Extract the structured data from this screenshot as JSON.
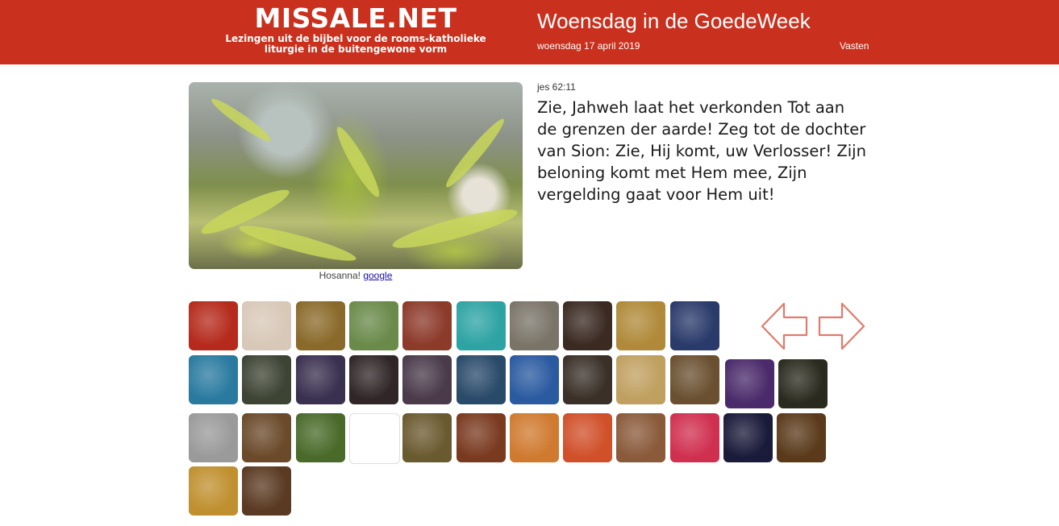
{
  "header": {
    "site_title": "MISSALE.NET",
    "site_subtitle_line1": "Lezingen uit de bijbel voor de rooms-katholieke",
    "site_subtitle_line2": "liturgie in de buitengewone vorm",
    "day_title": "Woensdag in de GoedeWeek",
    "date": "woensdag 17 april 2019",
    "season": "Vasten",
    "background_color": "#c9301d"
  },
  "feature": {
    "caption": "Hosanna!",
    "caption_link": "google"
  },
  "reading": {
    "reference": "jes 62:11",
    "text": "Zie, Jahweh laat het verkonden Tot aan de grenzen der aarde! Zeg tot de dochter van Sion: Zie, Hij komt, uw Verlosser! Zijn beloning komt met Hem mee, Zijn vergelding gaat voor Hem uit!"
  },
  "navigation": {
    "prev_icon": "arrow-left-icon",
    "next_icon": "arrow-right-icon",
    "arrow_color": "#e07b6d"
  },
  "gallery": {
    "thumbnails": [
      {
        "name": "thumb-crucifix-red",
        "color": "#b52a1c"
      },
      {
        "name": "thumb-pope",
        "color": "#d8c8b8"
      },
      {
        "name": "thumb-last-supper",
        "color": "#8a6a2a"
      },
      {
        "name": "thumb-stained-glass",
        "color": "#6a8a4a"
      },
      {
        "name": "thumb-supper-red",
        "color": "#8c3a2a"
      },
      {
        "name": "thumb-teal-circle",
        "color": "#2ea3a3"
      },
      {
        "name": "thumb-gethsemane-grey",
        "color": "#7a7468"
      },
      {
        "name": "thumb-kiss-judas",
        "color": "#3a2a22"
      },
      {
        "name": "thumb-rembrandt",
        "color": "#b08a3a"
      },
      {
        "name": "thumb-angel-blue",
        "color": "#2a3a6a"
      },
      {
        "name": "thumb-light-blue",
        "color": "#2a7aa0"
      },
      {
        "name": "thumb-agony-garden",
        "color": "#3e4434"
      },
      {
        "name": "thumb-arrest-crowd",
        "color": "#3a3050"
      },
      {
        "name": "thumb-dark-scene",
        "color": "#302628"
      },
      {
        "name": "thumb-peter-denial",
        "color": "#4a3a4a"
      },
      {
        "name": "thumb-jesus-crying",
        "color": "#2a4a6a"
      },
      {
        "name": "thumb-icon-jesus",
        "color": "#2a5aa0"
      },
      {
        "name": "thumb-mocking",
        "color": "#3a3028"
      },
      {
        "name": "thumb-pilate",
        "color": "#c0a060"
      },
      {
        "name": "thumb-crowd-yellow",
        "color": "#6a5030"
      },
      {
        "name": "thumb-silhouettes",
        "color": "#4a2a6a"
      },
      {
        "name": "thumb-dark-crowd",
        "color": "#2a2a1e"
      },
      {
        "name": "thumb-woodcut",
        "color": "#9a9a9a"
      },
      {
        "name": "thumb-carrying-cross",
        "color": "#6a4a2a"
      },
      {
        "name": "thumb-green-gold",
        "color": "#4a6a2a"
      },
      {
        "name": "thumb-into-your-hands",
        "color": "#ffffff"
      },
      {
        "name": "thumb-cross-road",
        "color": "#6a5a30"
      },
      {
        "name": "thumb-fire-scene",
        "color": "#7a3a20"
      },
      {
        "name": "thumb-modern-colors",
        "color": "#d07a30"
      },
      {
        "name": "thumb-orange",
        "color": "#d0502a"
      },
      {
        "name": "thumb-descent",
        "color": "#8a5a3a"
      },
      {
        "name": "thumb-red-blue",
        "color": "#d03050"
      },
      {
        "name": "thumb-crucifixion-night",
        "color": "#1a1a3a"
      },
      {
        "name": "thumb-ecce-homo",
        "color": "#5a3a1a"
      },
      {
        "name": "thumb-dead-christ",
        "color": "#c09030"
      },
      {
        "name": "thumb-crown-thorns",
        "color": "#5a3a22"
      }
    ]
  }
}
